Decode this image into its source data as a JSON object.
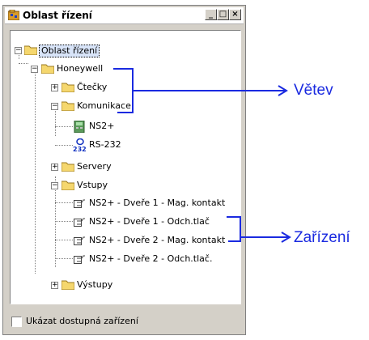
{
  "window": {
    "title": "Oblast řízení",
    "minimize": "_",
    "maximize": "□",
    "close": "×"
  },
  "tree": {
    "root": "Oblast řízení",
    "honeywell": "Honeywell",
    "ctecky": "Čtečky",
    "komunikace": "Komunikace",
    "ns2": "NS2+",
    "rs232": "RS-232",
    "rs232_badge": "232",
    "servery": "Servery",
    "vstupy": "Vstupy",
    "dev1": "NS2+ - Dveře 1 - Mag. kontakt",
    "dev2": "NS2+ - Dveře 1 - Odch.tlač",
    "dev3": "NS2+ - Dveře 2 - Mag. kontakt",
    "dev4": "NS2+ - Dveře 2 - Odch.tlač.",
    "vystupy": "Výstupy"
  },
  "footer": {
    "checkbox_label": "Ukázat dostupná zařízení",
    "checked": false
  },
  "annotations": {
    "vetev": "Větev",
    "zarizeni": "Zařízení"
  },
  "colors": {
    "annotation": "#1a2ae0",
    "folder": "#f5d76e"
  }
}
